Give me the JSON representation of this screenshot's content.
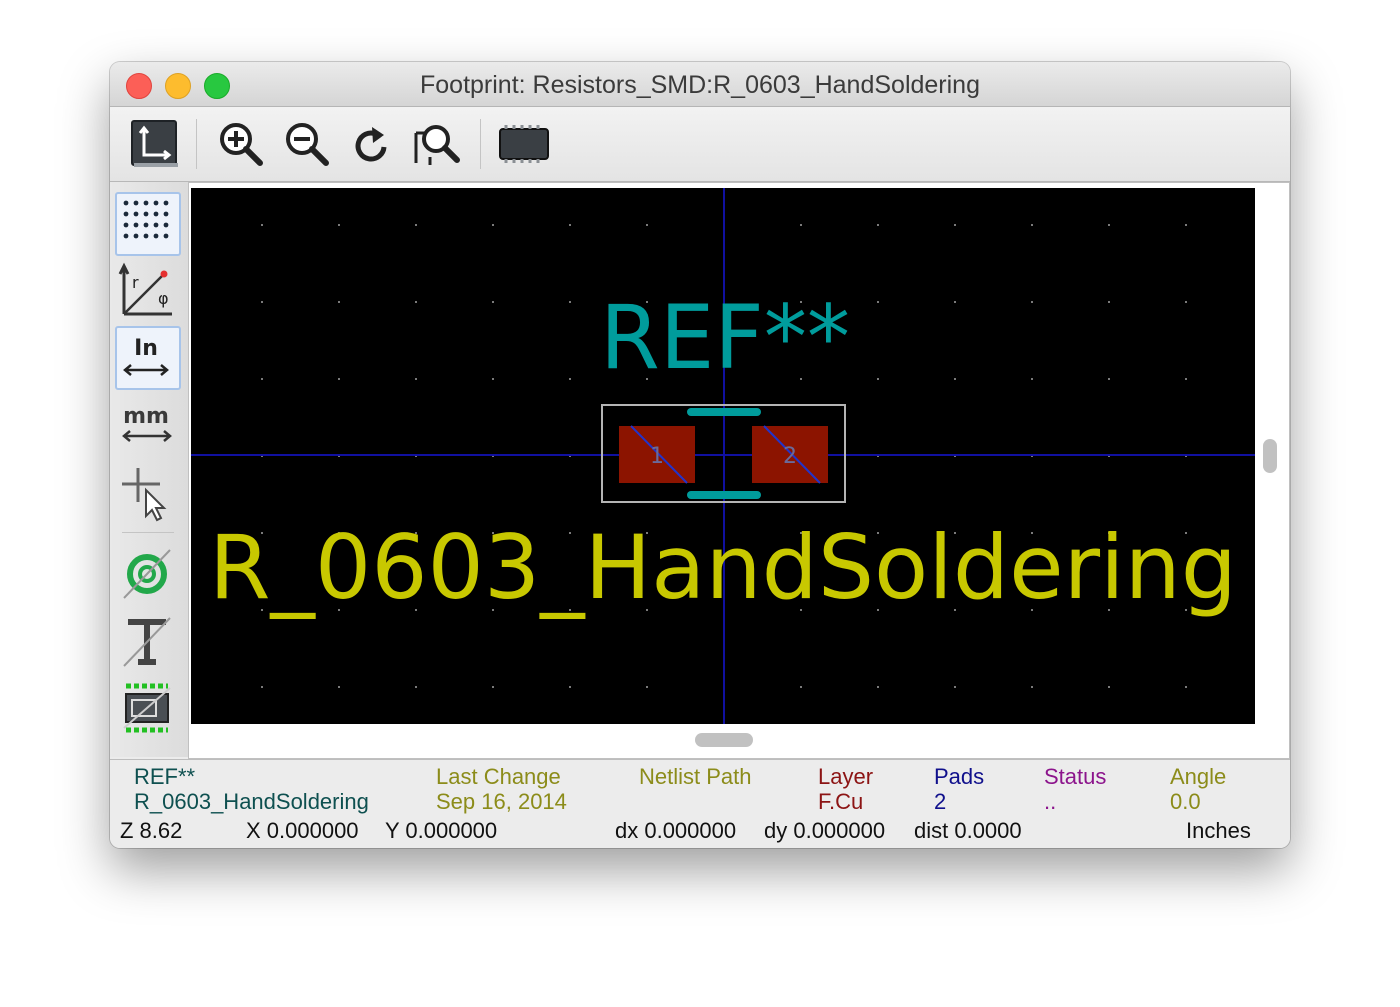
{
  "window": {
    "title": "Footprint: Resistors_SMD:R_0603_HandSoldering"
  },
  "toolbar": {
    "items": [
      {
        "name": "display-options-icon"
      },
      {
        "name": "zoom-in-icon"
      },
      {
        "name": "zoom-out-icon"
      },
      {
        "name": "redraw-icon"
      },
      {
        "name": "zoom-fit-icon"
      },
      {
        "name": "3d-view-icon"
      }
    ]
  },
  "left_toolbar": {
    "units_inch_label": "In",
    "units_mm_label": "mm",
    "polar_r_label": "r",
    "polar_phi_label": "φ"
  },
  "canvas": {
    "reference_text": "REF**",
    "value_text": "R_0603_HandSoldering",
    "pad1_label": "1",
    "pad2_label": "2",
    "colors": {
      "background": "#000000",
      "reference": "#009c9c",
      "value": "#c8c800",
      "pad": "#8c1400",
      "courtyard": "#b4b4b4",
      "axis": "#1010a0",
      "grid": "#7a7a7a"
    }
  },
  "info": {
    "module_ref": "REF**",
    "module_value": "R_0603_HandSoldering",
    "last_change_label": "Last Change",
    "last_change_value": "Sep 16, 2014",
    "netlist_label": "Netlist Path",
    "netlist_value": "",
    "layer_label": "Layer",
    "layer_value": "F.Cu",
    "pads_label": "Pads",
    "pads_value": "2",
    "status_label": "Status",
    "status_value": "..",
    "angle_label": "Angle",
    "angle_value": "0.0",
    "colors": {
      "ref": "#0e5050",
      "last_change": "#8c8c1a",
      "netlist": "#8c8c1a",
      "layer": "#8c1414",
      "pads": "#10108c",
      "status": "#8c148c",
      "angle": "#8c8c1a"
    }
  },
  "status": {
    "zoom": "Z 8.62",
    "x": "X 0.000000",
    "y": "Y 0.000000",
    "dx": "dx 0.000000",
    "dy": "dy 0.000000",
    "dist": "dist 0.0000",
    "units": "Inches"
  }
}
